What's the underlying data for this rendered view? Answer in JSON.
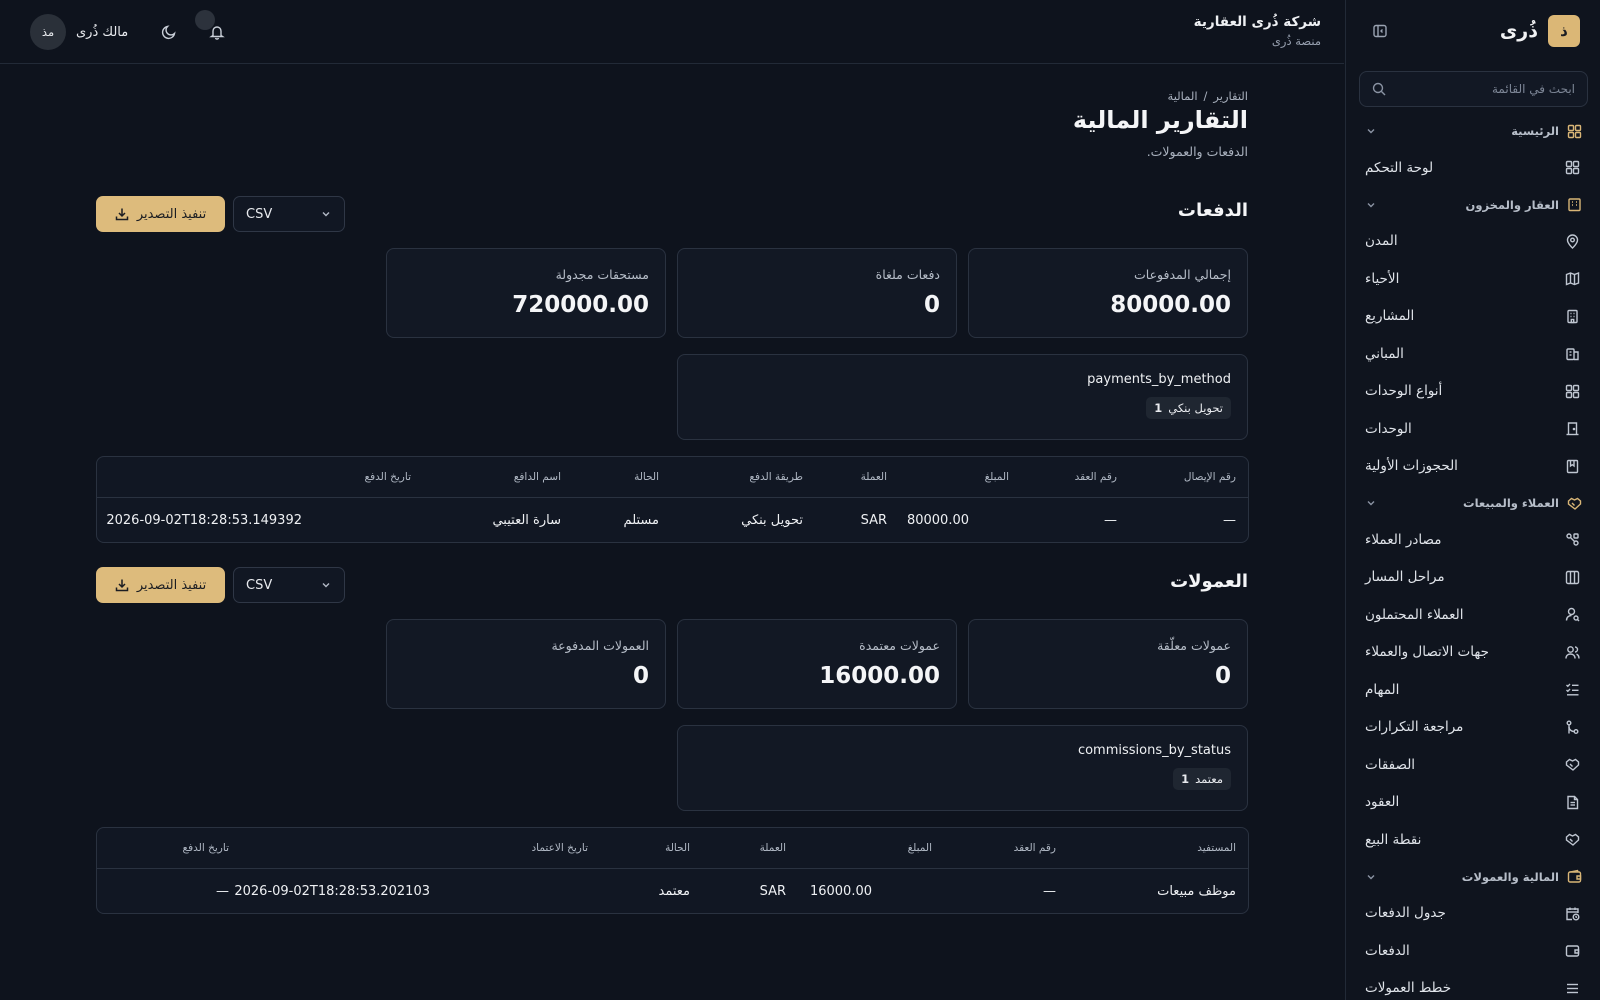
{
  "sidebar": {
    "brand_logo": "ذ",
    "brand_name": "ذُرى",
    "search_placeholder": "ابحث في القائمة",
    "groups": {
      "home": "الرئيسية",
      "property": "العقار والمخزون",
      "clients": "العملاء والمبيعات",
      "finance": "المالية والعمولات"
    },
    "items": {
      "dashboard": "لوحة التحكم",
      "cities": "المدن",
      "districts": "الأحياء",
      "projects": "المشاريع",
      "buildings": "المباني",
      "unit_types": "أنواع الوحدات",
      "units": "الوحدات",
      "reservations": "الحجوزات الأولية",
      "lead_sources": "مصادر العملاء",
      "pipeline_stages": "مراحل المسار",
      "leads": "العملاء المحتملون",
      "contacts": "جهات الاتصال والعملاء",
      "tasks": "المهام",
      "duplicates": "مراجعة التكرارات",
      "deals": "الصفقات",
      "contracts": "العقود",
      "pos": "نقطة البيع",
      "payment_schedule": "جدول الدفعات",
      "payments": "الدفعات",
      "commission_plans": "خطط العمولات"
    }
  },
  "topbar": {
    "org_name": "شركة ذُرى العقارية",
    "org_sub": "منصة ذُرى",
    "user_initials": "مذ",
    "user_name": "مالك ذُرى"
  },
  "page": {
    "breadcrumb_root": "التقارير",
    "breadcrumb_sep": "/",
    "breadcrumb_current": "المالية",
    "title": "التقارير المالية",
    "subtitle": "الدفعات والعمولات."
  },
  "payments": {
    "title": "الدفعات",
    "export_label": "تنفيذ التصدير",
    "format": "CSV",
    "cards": {
      "total_label": "إجمالي المدفوعات",
      "total_value": "80000.00",
      "cancelled_label": "دفعات ملغاة",
      "cancelled_value": "0",
      "scheduled_label": "مستحقات مجدولة",
      "scheduled_value": "720000.00"
    },
    "breakdown_title": "payments_by_method",
    "breakdown_chip_label": "تحويل بنكي",
    "breakdown_chip_count": "1",
    "table": {
      "headers": {
        "receipt": "رقم الإيصال",
        "contract": "رقم العقد",
        "amount": "المبلغ",
        "currency": "العملة",
        "method": "طريقة الدفع",
        "status": "الحالة",
        "payer": "اسم الدافع",
        "date": "تاريخ الدفع"
      },
      "row": {
        "receipt": "—",
        "contract": "—",
        "amount": "80000.00",
        "currency": "SAR",
        "method": "تحويل بنكي",
        "status": "مستلم",
        "payer": "سارة العتيبي",
        "date": "2026-09-02T18:28:53.149392"
      }
    }
  },
  "commissions": {
    "title": "العمولات",
    "export_label": "تنفيذ التصدير",
    "format": "CSV",
    "cards": {
      "pending_label": "عمولات معلّقة",
      "pending_value": "0",
      "approved_label": "عمولات معتمدة",
      "approved_value": "16000.00",
      "paid_label": "العمولات المدفوعة",
      "paid_value": "0"
    },
    "breakdown_title": "commissions_by_status",
    "breakdown_chip_label": "معتمد",
    "breakdown_chip_count": "1",
    "table": {
      "headers": {
        "beneficiary": "المستفيد",
        "contract": "رقم العقد",
        "amount": "المبلغ",
        "currency": "العملة",
        "status": "الحالة",
        "approved_at": "تاريخ الاعتماد",
        "paid_at": "تاريخ الدفع"
      },
      "row": {
        "beneficiary": "موظف مبيعات",
        "contract": "—",
        "amount": "16000.00",
        "currency": "SAR",
        "status": "معتمد",
        "approved_at": "2026-09-02T18:28:53.202103",
        "paid_at": "—"
      }
    }
  },
  "colors": {
    "accent": "#ddbb7c",
    "background": "#0e131d",
    "card": "#121824"
  }
}
